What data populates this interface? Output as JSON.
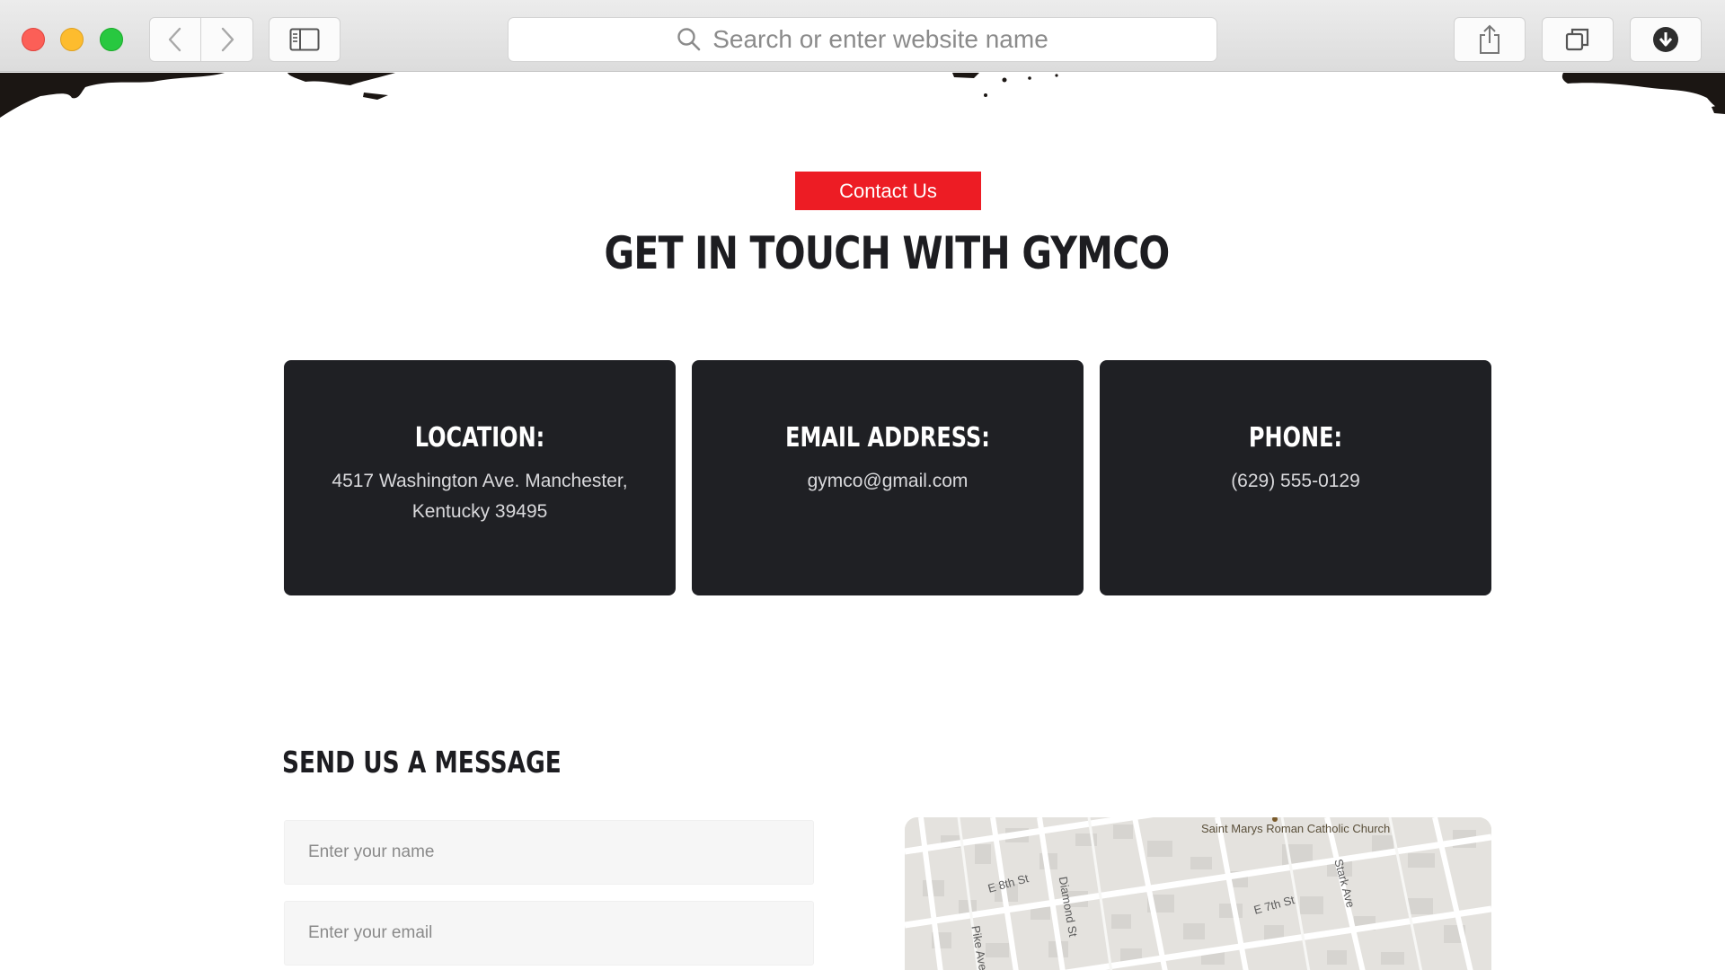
{
  "browser": {
    "address_placeholder": "Search or enter website name",
    "traffic_lights": {
      "close": "#fc5f57",
      "minimize": "#fdbc2e",
      "zoom": "#28c840"
    }
  },
  "page": {
    "badge": "Contact Us",
    "title": "GET IN TOUCH WITH GYMCO",
    "accent_color": "#ed1c24",
    "card_color": "#1f2024",
    "cards": [
      {
        "heading": "LOCATION:",
        "value": "4517 Washington Ave. Manchester, Kentucky 39495"
      },
      {
        "heading": "EMAIL ADDRESS:",
        "value": "gymco@gmail.com"
      },
      {
        "heading": "PHONE:",
        "value": "(629) 555-0129"
      }
    ],
    "message_heading": "SEND US A MESSAGE",
    "form": {
      "name_placeholder": "Enter your name",
      "email_placeholder": "Enter your email"
    },
    "map": {
      "poi": "Saint Marys Roman Catholic Church",
      "streets": [
        "E 8th St",
        "E 7th St",
        "Diamond St",
        "Pike Ave",
        "Stark Ave"
      ]
    }
  }
}
